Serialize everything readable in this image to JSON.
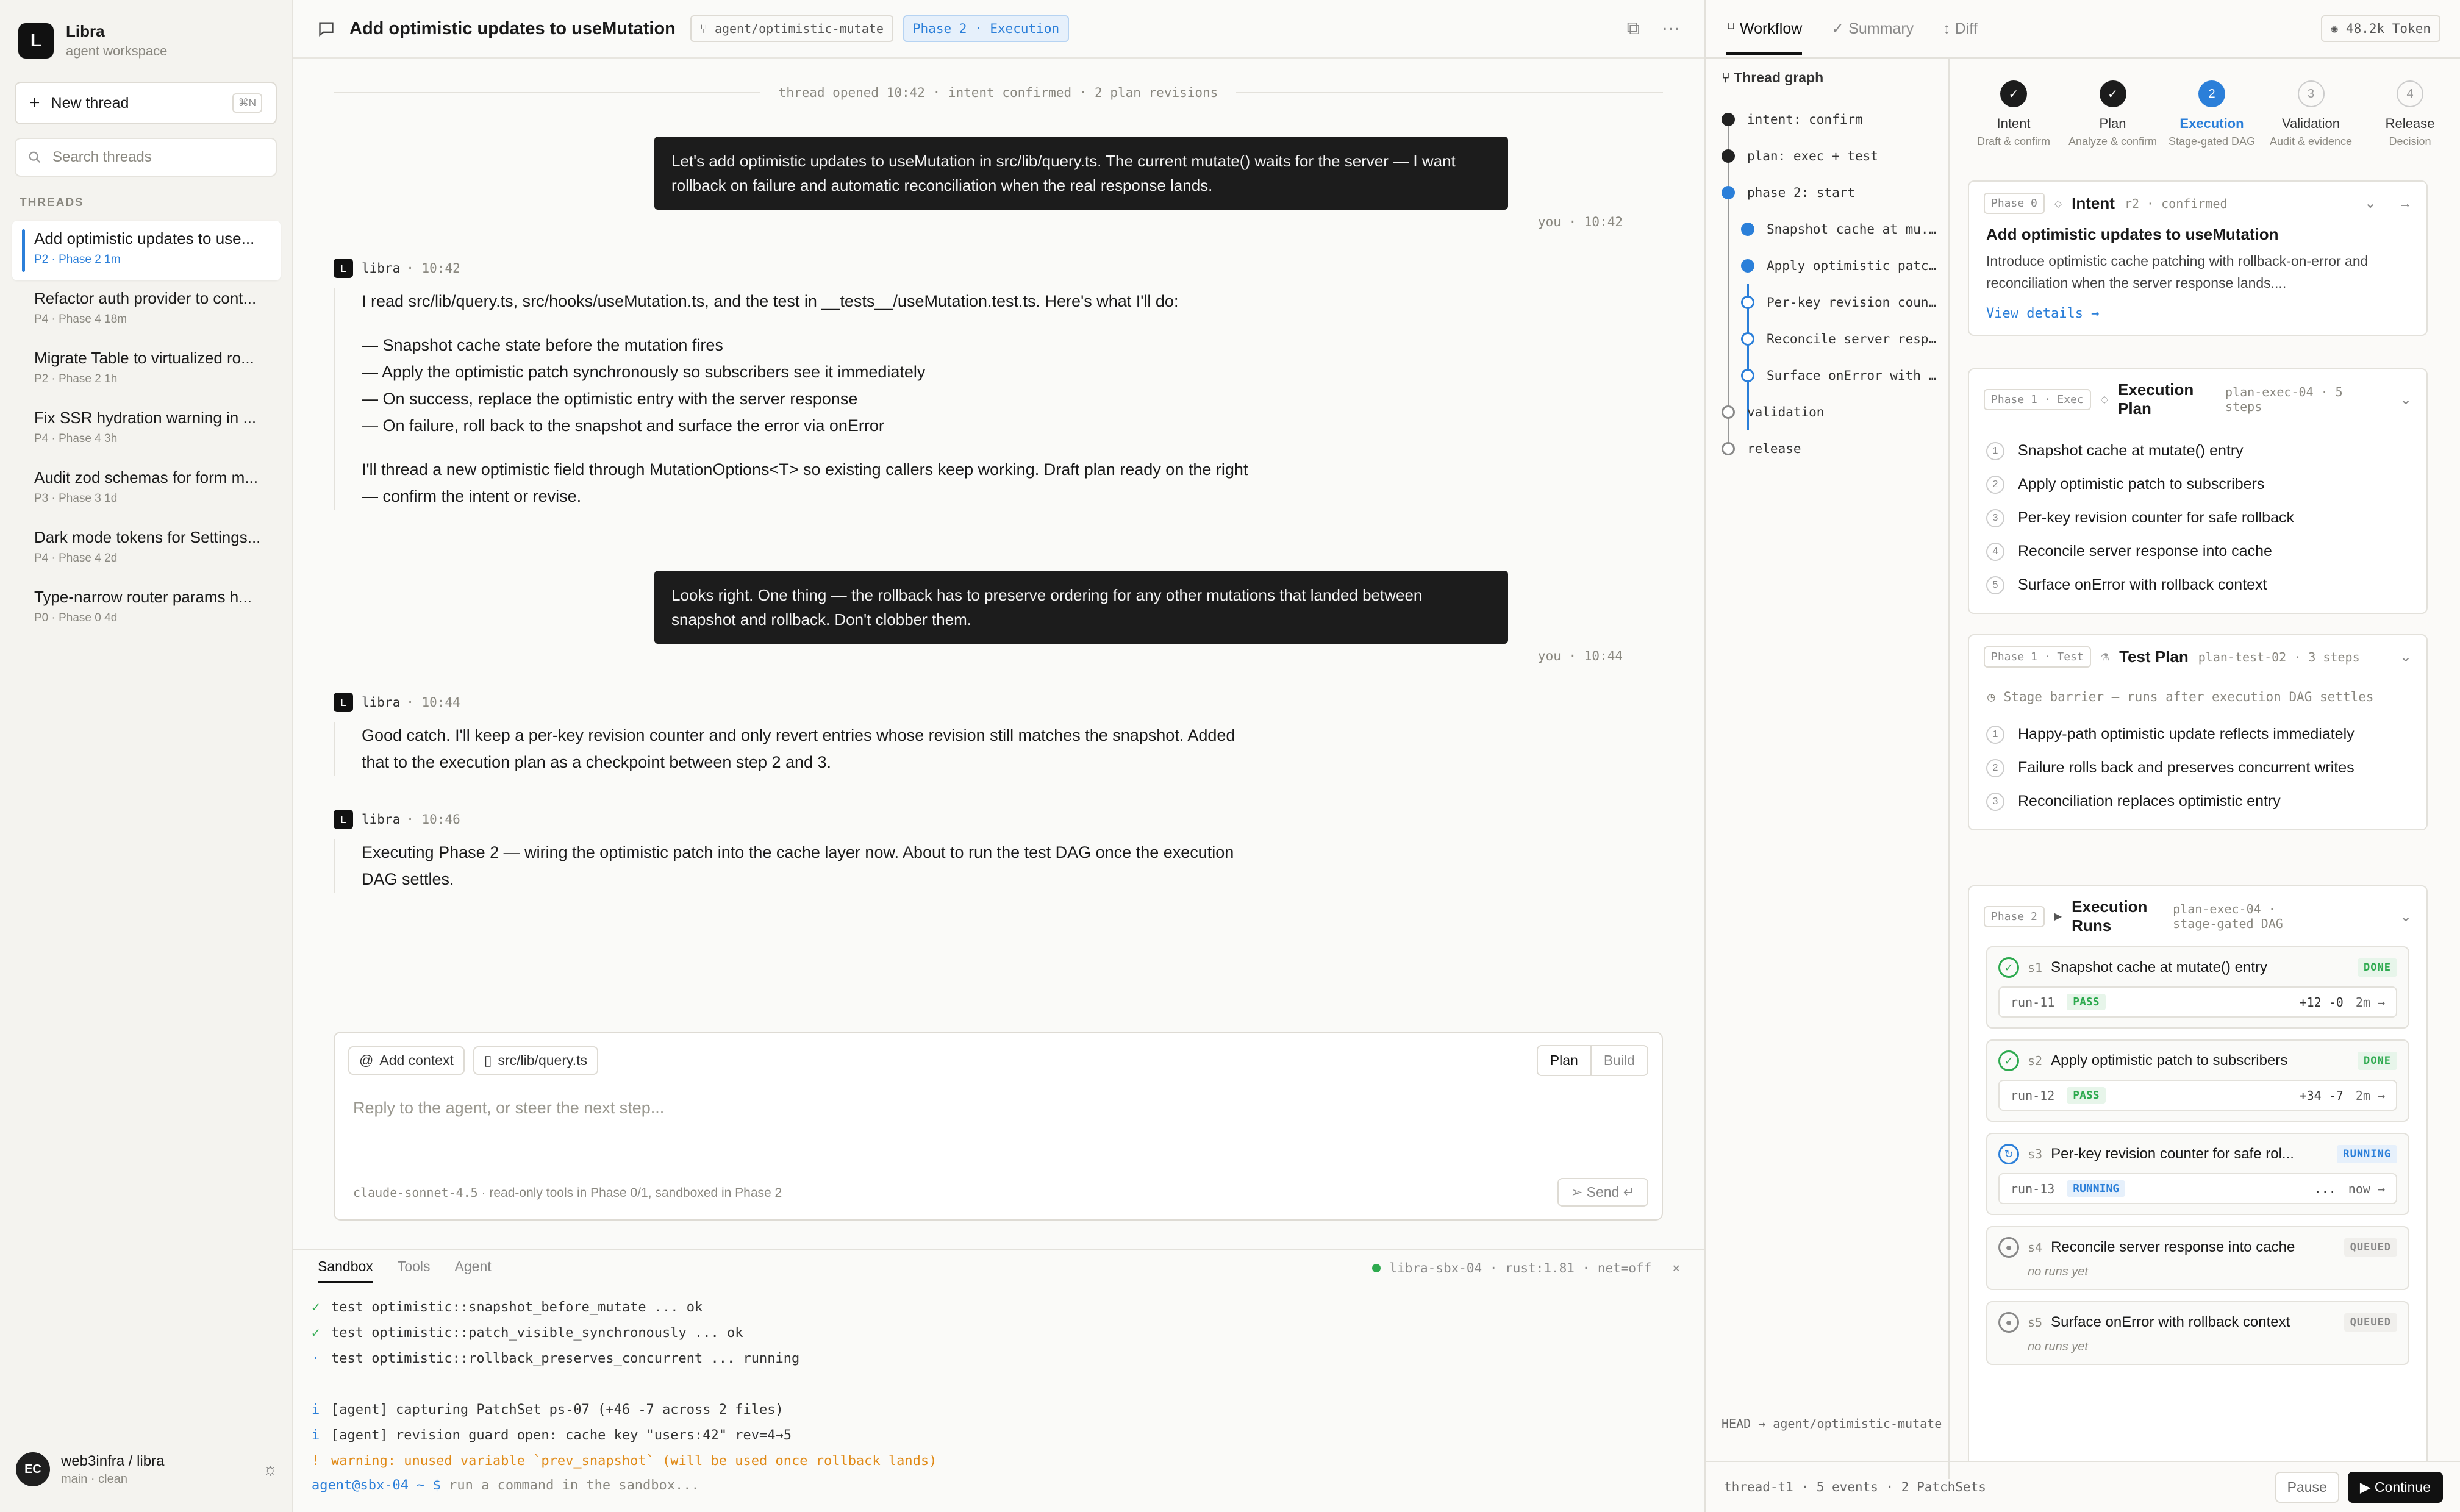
{
  "brand": {
    "name": "Libra",
    "subtitle": "agent workspace",
    "logo": "L"
  },
  "sidebar": {
    "new_thread": "New thread",
    "new_thread_kbd": "⌘N",
    "search_placeholder": "Search threads",
    "threads_label": "THREADS",
    "threads": [
      {
        "title": "Add optimistic updates to use...",
        "meta": "P2 · Phase 2 1m"
      },
      {
        "title": "Refactor auth provider to cont...",
        "meta": "P4 · Phase 4 18m"
      },
      {
        "title": "Migrate Table to virtualized ro...",
        "meta": "P2 · Phase 2 1h"
      },
      {
        "title": "Fix SSR hydration warning in ...",
        "meta": "P4 · Phase 4 3h"
      },
      {
        "title": "Audit zod schemas for form m...",
        "meta": "P3 · Phase 3 1d"
      },
      {
        "title": "Dark mode tokens for Settings...",
        "meta": "P4 · Phase 4 2d"
      },
      {
        "title": "Type-narrow router params h...",
        "meta": "P0 · Phase 0 4d"
      }
    ],
    "workspace": {
      "initials": "EC",
      "name": "web3infra / libra",
      "sub": "main · clean"
    }
  },
  "header": {
    "title": "Add optimistic updates to useMutation",
    "branch": "agent/optimistic-mutate",
    "phase": "Phase 2 · Execution"
  },
  "chat": {
    "divider": "thread opened 10:42 · intent confirmed · 2 plan revisions",
    "m1": "Let's add optimistic updates to useMutation in src/lib/query.ts. The current mutate() waits for the server — I want rollback on failure and automatic reconciliation when the real response lands.",
    "m1_meta": "you · 10:42",
    "a1_name": "libra",
    "a1_time": "· 10:42",
    "a1_p1": "I read src/lib/query.ts, src/hooks/useMutation.ts, and the test in __tests__/useMutation.test.ts. Here's what I'll do:",
    "a1_b1": "— Snapshot cache state before the mutation fires",
    "a1_b2": "— Apply the optimistic patch synchronously so subscribers see it immediately",
    "a1_b3": "— On success, replace the optimistic entry with the server response",
    "a1_b4": "— On failure, roll back to the snapshot and surface the error via onError",
    "a1_p2": "I'll thread a new optimistic field through MutationOptions<T> so existing callers keep working. Draft plan ready on the right — confirm the intent or revise.",
    "m2": "Looks right. One thing — the rollback has to preserve ordering for any other mutations that landed between snapshot and rollback. Don't clobber them.",
    "m2_meta": "you · 10:44",
    "a2_name": "libra",
    "a2_time": "· 10:44",
    "a2_p1": "Good catch. I'll keep a per-key revision counter and only revert entries whose revision still matches the snapshot. Added that to the execution plan as a checkpoint between step 2 and 3.",
    "a3_name": "libra",
    "a3_time": "· 10:46",
    "a3_p1": "Executing Phase 2 — wiring the optimistic patch into the cache layer now. About to run the test DAG once the execution DAG settles."
  },
  "composer": {
    "add_context": "Add context",
    "file_chip": "src/lib/query.ts",
    "mode_plan": "Plan",
    "mode_build": "Build",
    "placeholder": "Reply to the agent, or steer the next step...",
    "model": "claude-sonnet-4.5",
    "note": "read-only tools in Phase 0/1, sandboxed in Phase 2",
    "send": "Send ↵"
  },
  "terminal": {
    "tabs": [
      "Sandbox",
      "Tools",
      "Agent"
    ],
    "sandbox": "libra-sbx-04 · rust:1.81 · net=off",
    "lines": [
      {
        "mark": "✓",
        "text": "test optimistic::snapshot_before_mutate ... ok",
        "cls": "ok"
      },
      {
        "mark": "✓",
        "text": "test optimistic::patch_visible_synchronously ... ok",
        "cls": "ok"
      },
      {
        "mark": "·",
        "text": "test optimistic::rollback_preserves_concurrent ... running",
        "cls": "info"
      },
      {
        "mark": " ",
        "text": "",
        "cls": ""
      },
      {
        "mark": "i",
        "text": "[agent] capturing PatchSet ps-07 (+46 -7 across 2 files)",
        "cls": "info"
      },
      {
        "mark": "i",
        "text": "[agent] revision guard open: cache key \"users:42\" rev=4→5",
        "cls": "info"
      },
      {
        "mark": "!",
        "text": "warning: unused variable `prev_snapshot` (will be used once rollback lands)",
        "cls": "warn"
      }
    ],
    "prompt_user": "agent@sbx-04 ~ $",
    "prompt_ph": "run a command in the sandbox..."
  },
  "right": {
    "tabs": [
      "Workflow",
      "Summary",
      "Diff"
    ],
    "token": "48.2k Token",
    "graph_title": "Thread graph",
    "graph": [
      "intent: confirm",
      "plan: exec + test",
      "phase 2: start",
      "Snapshot cache at mu...",
      "Apply optimistic patch...",
      "Per-key revision count...",
      "Reconcile server resp...",
      "Surface onError with r...",
      "validation",
      "release"
    ],
    "head": "HEAD → agent/optimistic-mutate",
    "steps": [
      {
        "num": "",
        "name": "Intent",
        "desc": "Draft & confirm"
      },
      {
        "num": "",
        "name": "Plan",
        "desc": "Analyze & confirm"
      },
      {
        "num": "2",
        "name": "Execution",
        "desc": "Stage-gated DAG"
      },
      {
        "num": "3",
        "name": "Validation",
        "desc": "Audit & evidence"
      },
      {
        "num": "4",
        "name": "Release",
        "desc": "Decision"
      }
    ],
    "intent": {
      "phase": "Phase 0",
      "title": "Intent",
      "sub": "r2 · confirmed",
      "heading": "Add optimistic updates to useMutation",
      "desc": "Introduce optimistic cache patching with rollback-on-error and reconciliation when the server response lands....",
      "link": "View details →"
    },
    "exec": {
      "phase": "Phase 1 · Exec",
      "title": "Execution Plan",
      "sub": "plan-exec-04 · 5 steps",
      "items": [
        "Snapshot cache at mutate() entry",
        "Apply optimistic patch to subscribers",
        "Per-key revision counter for safe rollback",
        "Reconcile server response into cache",
        "Surface onError with rollback context"
      ]
    },
    "test": {
      "phase": "Phase 1 · Test",
      "title": "Test Plan",
      "sub": "plan-test-02 · 3 steps",
      "barrier": "Stage barrier — runs after execution DAG settles",
      "items": [
        "Happy-path optimistic update reflects immediately",
        "Failure rolls back and preserves concurrent writes",
        "Reconciliation replaces optimistic entry"
      ]
    },
    "runs": {
      "phase": "Phase 2",
      "title": "Execution Runs",
      "sub": "plan-exec-04 · stage-gated DAG",
      "items": [
        {
          "id": "s1",
          "name": "Snapshot cache at mutate() entry",
          "status": "DONE",
          "run": "run-11",
          "res": "PASS",
          "diff": "+12 -0",
          "time": "2m →"
        },
        {
          "id": "s2",
          "name": "Apply optimistic patch to subscribers",
          "status": "DONE",
          "run": "run-12",
          "res": "PASS",
          "diff": "+34 -7",
          "time": "2m →"
        },
        {
          "id": "s3",
          "name": "Per-key revision counter for safe rol...",
          "status": "RUNNING",
          "run": "run-13",
          "res": "RUNNING",
          "diff": "...",
          "time": "now →"
        },
        {
          "id": "s4",
          "name": "Reconcile server response into cache",
          "status": "QUEUED",
          "norun": "no runs yet"
        },
        {
          "id": "s5",
          "name": "Surface onError with rollback context",
          "status": "QUEUED",
          "norun": "no runs yet"
        }
      ]
    },
    "footer": "thread-t1 · 5 events · 2 PatchSets",
    "pause": "Pause",
    "continue": "▶ Continue"
  }
}
